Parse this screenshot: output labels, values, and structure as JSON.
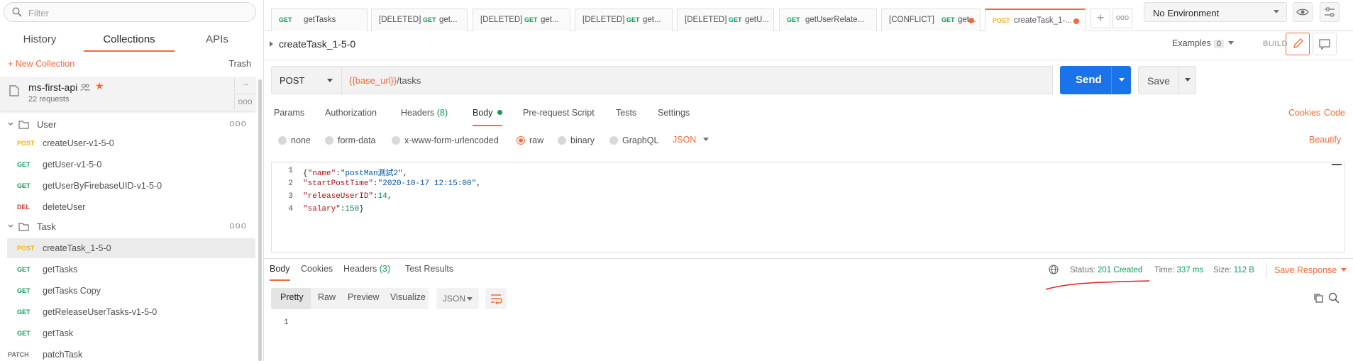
{
  "sidebar": {
    "filter_placeholder": "Filter",
    "tabs": [
      {
        "label": "History"
      },
      {
        "label": "Collections"
      },
      {
        "label": "APIs"
      }
    ],
    "new_collection": "+ New Collection",
    "trash": "Trash",
    "collection": {
      "name": "ms-first-api",
      "count": "22 requests"
    },
    "folders": [
      {
        "name": "User",
        "requests": [
          {
            "method": "POST",
            "name": "createUser-v1-5-0"
          },
          {
            "method": "GET",
            "name": "getUser-v1-5-0"
          },
          {
            "method": "GET",
            "name": "getUserByFirebaseUID-v1-5-0"
          },
          {
            "method": "DEL",
            "name": "deleteUser"
          }
        ]
      },
      {
        "name": "Task",
        "requests": [
          {
            "method": "POST",
            "name": "createTask_1-5-0"
          },
          {
            "method": "GET",
            "name": "getTasks"
          },
          {
            "method": "GET",
            "name": "getTasks Copy"
          },
          {
            "method": "GET",
            "name": "getReleaseUserTasks-v1-5-0"
          },
          {
            "method": "GET",
            "name": "getTask"
          },
          {
            "method": "PATCH",
            "name": "patchTask"
          }
        ]
      }
    ],
    "more": "ooo"
  },
  "tabs": [
    {
      "prefix": "",
      "method": "GET",
      "name": "getTasks"
    },
    {
      "prefix": "[DELETED]",
      "method": "GET",
      "name": "get..."
    },
    {
      "prefix": "[DELETED]",
      "method": "GET",
      "name": "get..."
    },
    {
      "prefix": "[DELETED]",
      "method": "GET",
      "name": "get..."
    },
    {
      "prefix": "[DELETED]",
      "method": "GET",
      "name": "getU..."
    },
    {
      "prefix": "",
      "method": "GET",
      "name": "getUserRelate..."
    },
    {
      "prefix": "[CONFLICT]",
      "method": "GET",
      "name": "get..."
    },
    {
      "prefix": "",
      "method": "POST",
      "name": "createTask_1-..."
    }
  ],
  "tab_plus": "+",
  "tab_more": "ooo",
  "environment": "No Environment",
  "request": {
    "name": "createTask_1-5-0",
    "examples_label": "Examples",
    "examples_count": "0",
    "build": "BUILD",
    "method": "POST",
    "url_var": "{{base_url}}",
    "url_path": "/tasks",
    "send": "Send",
    "save": "Save"
  },
  "request_tabs": {
    "params": "Params",
    "authorization": "Authorization",
    "headers": "Headers",
    "headers_count": "(8)",
    "body": "Body",
    "prerequest": "Pre-request Script",
    "tests": "Tests",
    "settings": "Settings",
    "cookies": "Cookies",
    "code": "Code"
  },
  "body_types": {
    "none": "none",
    "form_data": "form-data",
    "urlencoded": "x-www-form-urlencoded",
    "raw": "raw",
    "binary": "binary",
    "graphql": "GraphQL",
    "format": "JSON",
    "beautify": "Beautify"
  },
  "editor_lines": [
    {
      "n": "1",
      "k": "\"name\"",
      "v": "\"postMan測試2\"",
      "vt": "s",
      "open": "{",
      "end": ","
    },
    {
      "n": "2",
      "k": "\"startPostTime\"",
      "v": "\"2020-10-17 12:15:00\"",
      "vt": "s",
      "open": "",
      "end": ","
    },
    {
      "n": "3",
      "k": "\"releaseUserID\"",
      "v": "14",
      "vt": "n",
      "open": "",
      "end": ","
    },
    {
      "n": "4",
      "k": "\"salary\"",
      "v": "150",
      "vt": "n",
      "open": "",
      "end": "}"
    }
  ],
  "response": {
    "tabs": {
      "body": "Body",
      "cookies": "Cookies",
      "headers": "Headers",
      "headers_count": "(3)",
      "tests": "Test Results"
    },
    "status_label": "Status:",
    "status": "201 Created",
    "time_label": "Time:",
    "time": "337 ms",
    "size_label": "Size:",
    "size": "112 B",
    "save_response": "Save Response",
    "formats": {
      "pretty": "Pretty",
      "raw": "Raw",
      "preview": "Preview",
      "visualize": "Visualize"
    },
    "format": "JSON",
    "line": "1"
  },
  "colors": {
    "accent": "#f26b3a",
    "send": "#1a73e8",
    "get": "#0f9d58",
    "post": "#f4b400",
    "delete": "#c0392b",
    "annotation": "#e02020"
  }
}
